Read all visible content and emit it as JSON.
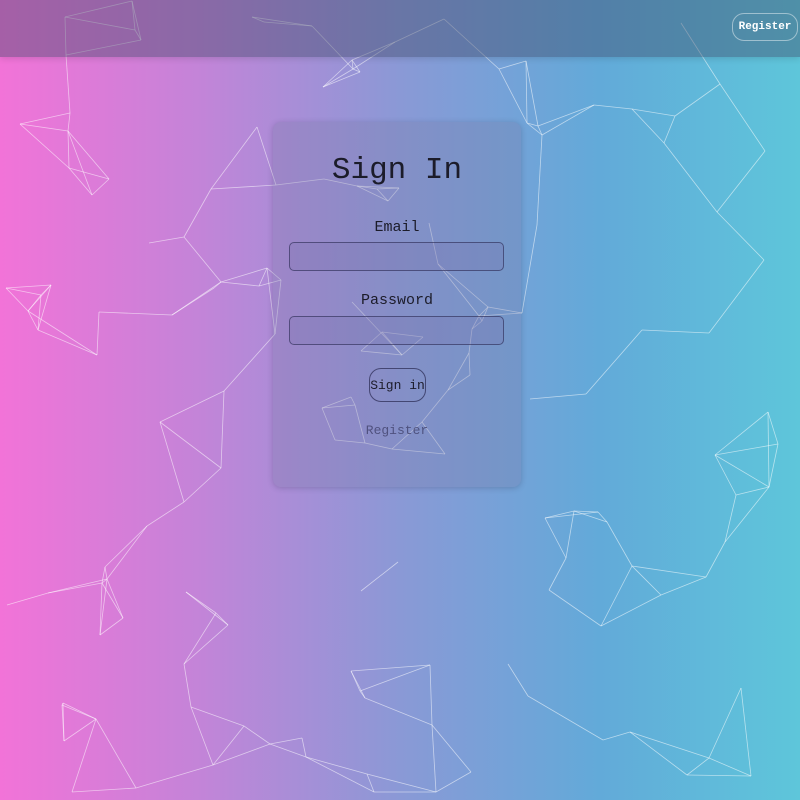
{
  "topbar": {
    "register_label": "Register"
  },
  "signin": {
    "title": "Sign In",
    "email_label": "Email",
    "email_value": "",
    "password_label": "Password",
    "password_value": "",
    "submit_label": "Sign in",
    "register_link": "Register"
  },
  "colors": {
    "gradient_left": "#f273d8",
    "gradient_right": "#5ec6da",
    "network_lines": "#ffffff"
  }
}
